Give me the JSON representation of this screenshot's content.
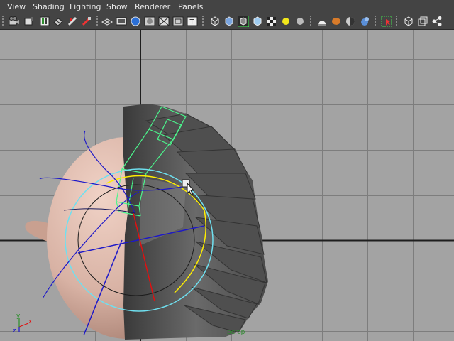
{
  "menubar": {
    "items": [
      {
        "label": "View"
      },
      {
        "label": "Shading"
      },
      {
        "label": "Lighting"
      },
      {
        "label": "Show"
      },
      {
        "label": "Renderer"
      },
      {
        "label": "Panels"
      }
    ]
  },
  "toolbar": {
    "icons": [
      "camera-attributes-icon",
      "bookmark-camera-icon",
      "image-plane-icon",
      "2d-pan-zoom-icon",
      "grease-pencil-icon",
      "snapshot-icon",
      "grid-icon",
      "film-gate-icon",
      "resolution-gate-icon",
      "gate-mask-icon",
      "field-chart-icon",
      "safe-action-icon",
      "safe-title-icon",
      "wireframe-icon",
      "smooth-shade-icon",
      "wireframe-on-shaded-icon",
      "xray-icon",
      "textured-icon",
      "use-all-lights-icon",
      "shadows-icon",
      "hardware-fog-icon",
      "motion-blur-icon",
      "ambient-occlusion-icon",
      "antialiasing-icon",
      "isolate-select-icon",
      "xray-joints-icon",
      "xray-active-components-icon",
      "backface-culling-icon"
    ]
  },
  "viewport": {
    "camera_label": "persp",
    "axis_labels": {
      "x": "x",
      "y": "y",
      "z": "z"
    },
    "colors": {
      "background": "#a3a3a3",
      "grid": "#7d7d7d",
      "origin_lines": "#222222",
      "skin": "#d8b2a4",
      "hair": "#575757",
      "selection_green": "#4bf58c",
      "light_blue_circle": "#6fe0f0",
      "yellow_circle": "#ffee00",
      "blue_axis": "#1d18c8",
      "red_axis": "#e01010"
    }
  }
}
